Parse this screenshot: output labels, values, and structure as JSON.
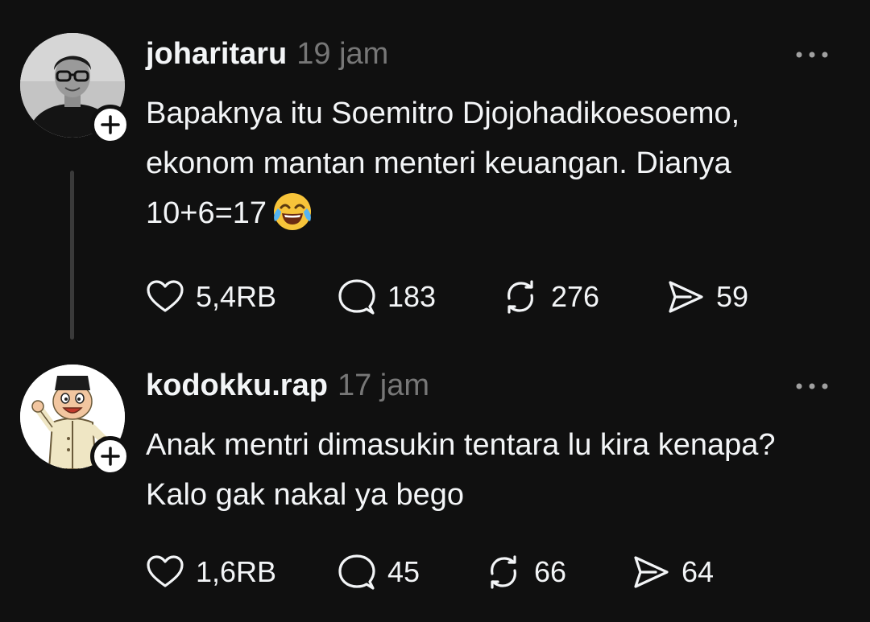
{
  "posts": [
    {
      "username": "joharitaru",
      "time": "19 jam",
      "text": "Bapaknya itu Soemitro Djojohadikoesoemo, ekonom mantan menteri keuangan. Dianya 10+6=17",
      "emoji": "face-with-tears-of-joy",
      "likes": "5,4RB",
      "replies": "183",
      "reposts": "276",
      "shares": "59"
    },
    {
      "username": "kodokku.rap",
      "time": "17 jam",
      "text": "Anak mentri dimasukin tentara lu kira kenapa? Kalo gak nakal ya bego",
      "likes": "1,6RB",
      "replies": "45",
      "reposts": "66",
      "shares": "64"
    }
  ],
  "icons": {
    "like": "heart-icon",
    "reply": "comment-bubble-icon",
    "repost": "repost-icon",
    "share": "send-icon",
    "more": "more-options-icon",
    "follow": "plus-icon"
  },
  "colors": {
    "background": "#101010",
    "text": "#f3f5f7",
    "secondary": "#777777",
    "thread_line": "#3a3a3a"
  }
}
